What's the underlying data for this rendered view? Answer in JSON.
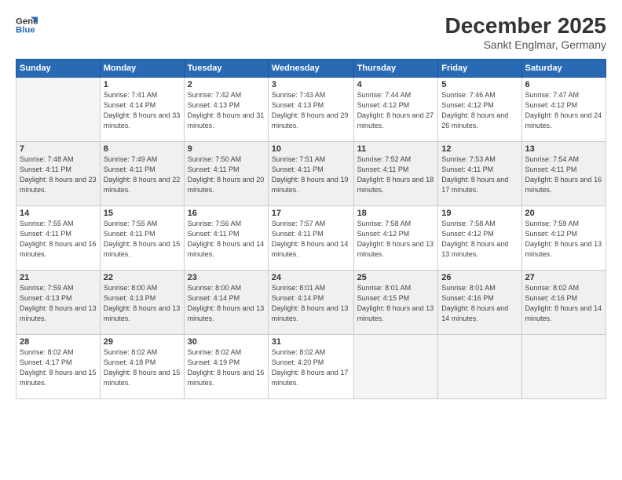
{
  "logo": {
    "line1": "General",
    "line2": "Blue"
  },
  "title": "December 2025",
  "subtitle": "Sankt Englmar, Germany",
  "days_of_week": [
    "Sunday",
    "Monday",
    "Tuesday",
    "Wednesday",
    "Thursday",
    "Friday",
    "Saturday"
  ],
  "weeks": [
    [
      {
        "day": "",
        "sunrise": "",
        "sunset": "",
        "daylight": "",
        "empty": true
      },
      {
        "day": "1",
        "sunrise": "Sunrise: 7:41 AM",
        "sunset": "Sunset: 4:14 PM",
        "daylight": "Daylight: 8 hours and 33 minutes."
      },
      {
        "day": "2",
        "sunrise": "Sunrise: 7:42 AM",
        "sunset": "Sunset: 4:13 PM",
        "daylight": "Daylight: 8 hours and 31 minutes."
      },
      {
        "day": "3",
        "sunrise": "Sunrise: 7:43 AM",
        "sunset": "Sunset: 4:13 PM",
        "daylight": "Daylight: 8 hours and 29 minutes."
      },
      {
        "day": "4",
        "sunrise": "Sunrise: 7:44 AM",
        "sunset": "Sunset: 4:12 PM",
        "daylight": "Daylight: 8 hours and 27 minutes."
      },
      {
        "day": "5",
        "sunrise": "Sunrise: 7:46 AM",
        "sunset": "Sunset: 4:12 PM",
        "daylight": "Daylight: 8 hours and 26 minutes."
      },
      {
        "day": "6",
        "sunrise": "Sunrise: 7:47 AM",
        "sunset": "Sunset: 4:12 PM",
        "daylight": "Daylight: 8 hours and 24 minutes."
      }
    ],
    [
      {
        "day": "7",
        "sunrise": "Sunrise: 7:48 AM",
        "sunset": "Sunset: 4:11 PM",
        "daylight": "Daylight: 8 hours and 23 minutes."
      },
      {
        "day": "8",
        "sunrise": "Sunrise: 7:49 AM",
        "sunset": "Sunset: 4:11 PM",
        "daylight": "Daylight: 8 hours and 22 minutes."
      },
      {
        "day": "9",
        "sunrise": "Sunrise: 7:50 AM",
        "sunset": "Sunset: 4:11 PM",
        "daylight": "Daylight: 8 hours and 20 minutes."
      },
      {
        "day": "10",
        "sunrise": "Sunrise: 7:51 AM",
        "sunset": "Sunset: 4:11 PM",
        "daylight": "Daylight: 8 hours and 19 minutes."
      },
      {
        "day": "11",
        "sunrise": "Sunrise: 7:52 AM",
        "sunset": "Sunset: 4:11 PM",
        "daylight": "Daylight: 8 hours and 18 minutes."
      },
      {
        "day": "12",
        "sunrise": "Sunrise: 7:53 AM",
        "sunset": "Sunset: 4:11 PM",
        "daylight": "Daylight: 8 hours and 17 minutes."
      },
      {
        "day": "13",
        "sunrise": "Sunrise: 7:54 AM",
        "sunset": "Sunset: 4:11 PM",
        "daylight": "Daylight: 8 hours and 16 minutes."
      }
    ],
    [
      {
        "day": "14",
        "sunrise": "Sunrise: 7:55 AM",
        "sunset": "Sunset: 4:11 PM",
        "daylight": "Daylight: 8 hours and 16 minutes."
      },
      {
        "day": "15",
        "sunrise": "Sunrise: 7:55 AM",
        "sunset": "Sunset: 4:11 PM",
        "daylight": "Daylight: 8 hours and 15 minutes."
      },
      {
        "day": "16",
        "sunrise": "Sunrise: 7:56 AM",
        "sunset": "Sunset: 4:11 PM",
        "daylight": "Daylight: 8 hours and 14 minutes."
      },
      {
        "day": "17",
        "sunrise": "Sunrise: 7:57 AM",
        "sunset": "Sunset: 4:11 PM",
        "daylight": "Daylight: 8 hours and 14 minutes."
      },
      {
        "day": "18",
        "sunrise": "Sunrise: 7:58 AM",
        "sunset": "Sunset: 4:12 PM",
        "daylight": "Daylight: 8 hours and 13 minutes."
      },
      {
        "day": "19",
        "sunrise": "Sunrise: 7:58 AM",
        "sunset": "Sunset: 4:12 PM",
        "daylight": "Daylight: 8 hours and 13 minutes."
      },
      {
        "day": "20",
        "sunrise": "Sunrise: 7:59 AM",
        "sunset": "Sunset: 4:12 PM",
        "daylight": "Daylight: 8 hours and 13 minutes."
      }
    ],
    [
      {
        "day": "21",
        "sunrise": "Sunrise: 7:59 AM",
        "sunset": "Sunset: 4:13 PM",
        "daylight": "Daylight: 8 hours and 13 minutes."
      },
      {
        "day": "22",
        "sunrise": "Sunrise: 8:00 AM",
        "sunset": "Sunset: 4:13 PM",
        "daylight": "Daylight: 8 hours and 13 minutes."
      },
      {
        "day": "23",
        "sunrise": "Sunrise: 8:00 AM",
        "sunset": "Sunset: 4:14 PM",
        "daylight": "Daylight: 8 hours and 13 minutes."
      },
      {
        "day": "24",
        "sunrise": "Sunrise: 8:01 AM",
        "sunset": "Sunset: 4:14 PM",
        "daylight": "Daylight: 8 hours and 13 minutes."
      },
      {
        "day": "25",
        "sunrise": "Sunrise: 8:01 AM",
        "sunset": "Sunset: 4:15 PM",
        "daylight": "Daylight: 8 hours and 13 minutes."
      },
      {
        "day": "26",
        "sunrise": "Sunrise: 8:01 AM",
        "sunset": "Sunset: 4:16 PM",
        "daylight": "Daylight: 8 hours and 14 minutes."
      },
      {
        "day": "27",
        "sunrise": "Sunrise: 8:02 AM",
        "sunset": "Sunset: 4:16 PM",
        "daylight": "Daylight: 8 hours and 14 minutes."
      }
    ],
    [
      {
        "day": "28",
        "sunrise": "Sunrise: 8:02 AM",
        "sunset": "Sunset: 4:17 PM",
        "daylight": "Daylight: 8 hours and 15 minutes."
      },
      {
        "day": "29",
        "sunrise": "Sunrise: 8:02 AM",
        "sunset": "Sunset: 4:18 PM",
        "daylight": "Daylight: 8 hours and 15 minutes."
      },
      {
        "day": "30",
        "sunrise": "Sunrise: 8:02 AM",
        "sunset": "Sunset: 4:19 PM",
        "daylight": "Daylight: 8 hours and 16 minutes."
      },
      {
        "day": "31",
        "sunrise": "Sunrise: 8:02 AM",
        "sunset": "Sunset: 4:20 PM",
        "daylight": "Daylight: 8 hours and 17 minutes."
      },
      {
        "day": "",
        "sunrise": "",
        "sunset": "",
        "daylight": "",
        "empty": true
      },
      {
        "day": "",
        "sunrise": "",
        "sunset": "",
        "daylight": "",
        "empty": true
      },
      {
        "day": "",
        "sunrise": "",
        "sunset": "",
        "daylight": "",
        "empty": true
      }
    ]
  ]
}
